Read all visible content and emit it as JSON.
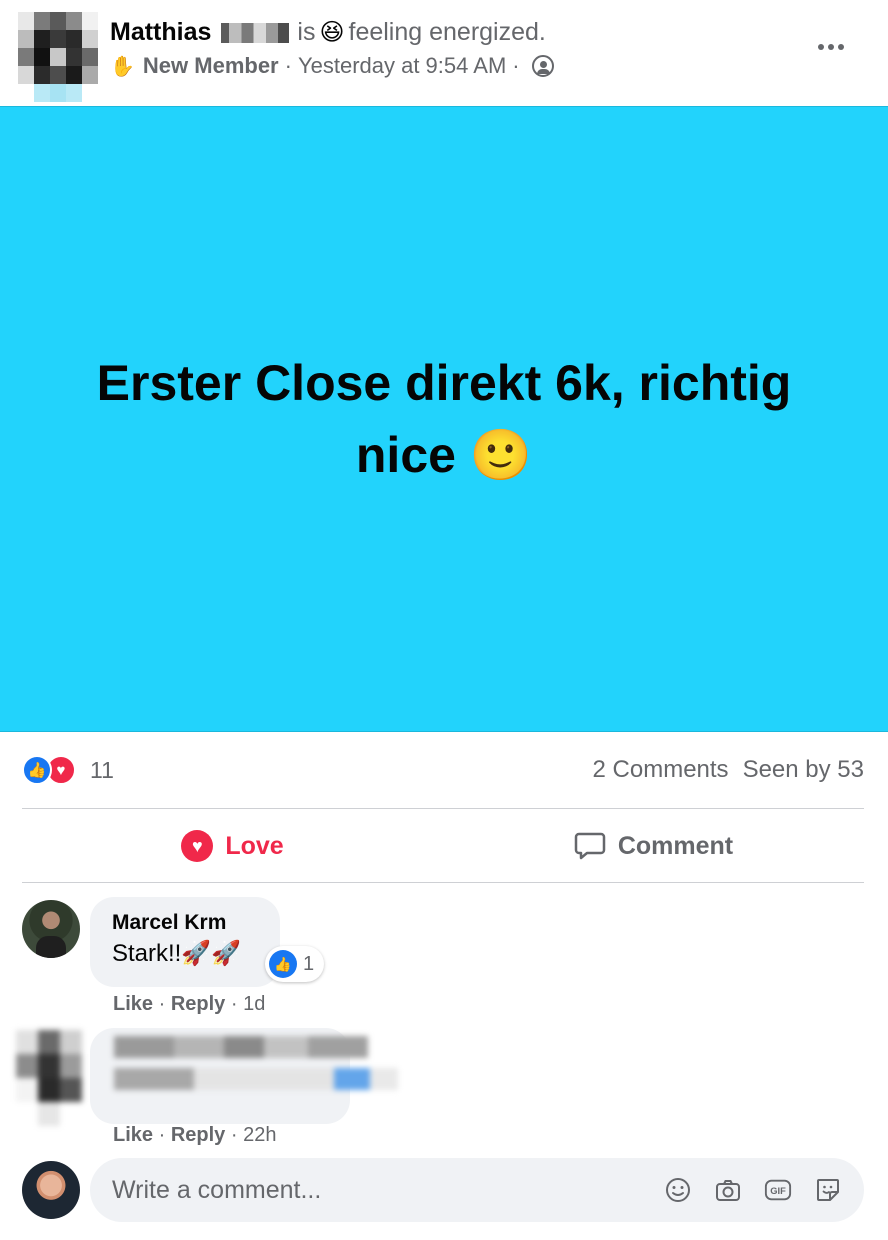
{
  "post": {
    "author": "Matthias",
    "verb": "is",
    "feeling_emoji": "😆",
    "feeling_text": "feeling energized.",
    "badge_icon": "waving-hand-icon",
    "badge": "New Member",
    "time": "Yesterday at 9:54 AM",
    "sep": "·",
    "content_line1": "Erster Close direkt 6k, richtig",
    "content_line2": "nice 🙂",
    "background_color": "#22d3fc"
  },
  "stats": {
    "reaction_count": "11",
    "comments": "2 Comments",
    "seen": "Seen by 53"
  },
  "actions": {
    "love": "Love",
    "comment": "Comment"
  },
  "comments": [
    {
      "name": "Marcel Krm",
      "text": "Stark!!🚀🚀",
      "reaction_count": "1",
      "like": "Like",
      "reply": "Reply",
      "time": "1d"
    },
    {
      "like": "Like",
      "reply": "Reply",
      "time": "22h"
    }
  ],
  "composer": {
    "placeholder": "Write a comment...",
    "icons": [
      "smiley-icon",
      "camera-icon",
      "gif-icon",
      "sticker-icon"
    ]
  },
  "colors": {
    "like_blue": "#1877f2",
    "love_red": "#f0284a",
    "muted": "#65676b"
  }
}
